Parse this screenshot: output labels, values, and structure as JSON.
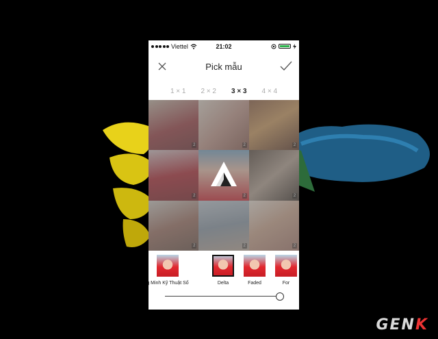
{
  "status_bar": {
    "carrier": "Viettel",
    "time": "21:02"
  },
  "nav": {
    "title": "Pick mẫu",
    "close_icon": "close-icon",
    "done_icon": "checkmark-icon"
  },
  "grid_options": [
    "1 × 1",
    "2 × 2",
    "3 × 3",
    "4 × 4"
  ],
  "selected_grid": "3 × 3",
  "photos": [
    {
      "badge": "2"
    },
    {
      "badge": "2"
    },
    {
      "badge": "2"
    },
    {
      "badge": "2"
    },
    {
      "badge": "2"
    },
    {
      "badge": "2"
    },
    {
      "badge": "2"
    },
    {
      "badge": "2"
    },
    {
      "badge": "2"
    }
  ],
  "filters": [
    {
      "label": "g Minh Kỹ Thuật Số"
    },
    {
      "label": "Delta"
    },
    {
      "label": "Faded"
    },
    {
      "label": "For"
    }
  ],
  "selected_filter": "Delta",
  "slider": {
    "value": 1.0
  },
  "watermark": {
    "text_a": "GEN",
    "text_b": "K"
  },
  "colors": {
    "accent": "#2ab34a",
    "background": "#000000"
  }
}
